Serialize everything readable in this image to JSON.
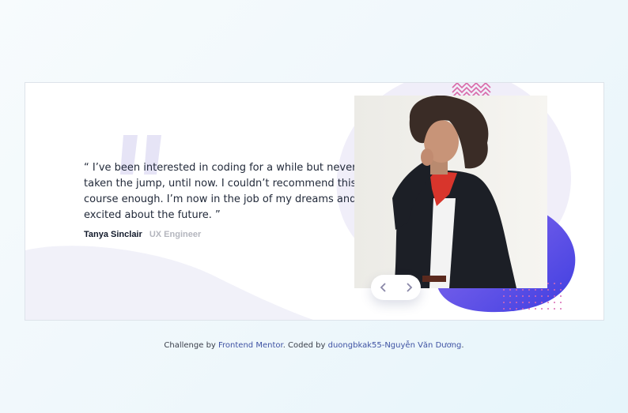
{
  "testimonial": {
    "quote": "“ I’ve been interested in coding for a while but never taken the jump, until now. I couldn’t recommend this course enough. I’m now in the job of my dreams and so excited about the future. ”",
    "author_name": "Tanya Sinclair",
    "author_role": "UX Engineer"
  },
  "photo": {
    "alt": "Tanya Sinclair"
  },
  "navigation": {
    "prev_icon": "chevron-left-icon",
    "next_icon": "chevron-right-icon"
  },
  "footer": {
    "prefix": "Challenge by ",
    "link1": "Frontend Mentor",
    "middle": ". Coded by ",
    "link2": "duongbkak55-Nguyễn Văn Dương",
    "suffix": "."
  },
  "colors": {
    "accent_purple": "#6a4fe0",
    "quote_mark": "#e6e4f6",
    "zigzag": "#d96aa8",
    "dots": "#d86bb4",
    "author_role": "#b4b6be"
  }
}
